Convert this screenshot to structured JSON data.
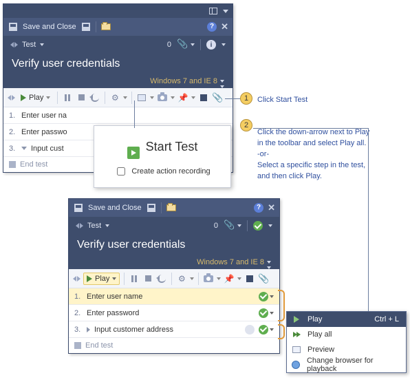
{
  "panel1": {
    "save_close": "Save and Close",
    "test_label": "Test",
    "count": "0",
    "title": "Verify user credentials",
    "config": "Windows 7 and IE 8",
    "play_label": "Play",
    "steps": [
      {
        "num": "1.",
        "text": "Enter user na"
      },
      {
        "num": "2.",
        "text": "Enter passwo"
      },
      {
        "num": "3.",
        "text": "Input cust"
      }
    ],
    "end": "End test"
  },
  "dialog": {
    "title": "Start Test",
    "checkbox": "Create action recording"
  },
  "panel2": {
    "save_close": "Save and Close",
    "test_label": "Test",
    "count": "0",
    "title": "Verify user credentials",
    "config": "Windows 7 and IE 8",
    "play_label": "Play",
    "steps": [
      {
        "num": "1.",
        "text": "Enter user name"
      },
      {
        "num": "2.",
        "text": "Enter password"
      },
      {
        "num": "3.",
        "text": "Input customer address"
      }
    ],
    "end": "End test"
  },
  "annotations": {
    "c1": "Click Start Test",
    "c2": "Click the down-arrow next to Play in the toolbar and select Play all.\n-or-\nSelect a specific step in the test, and then click Play."
  },
  "menu": {
    "items": [
      {
        "label": "Play",
        "shortcut": "Ctrl + L"
      },
      {
        "label": "Play all"
      },
      {
        "label": "Preview"
      },
      {
        "label": "Change browser for playback"
      }
    ]
  }
}
